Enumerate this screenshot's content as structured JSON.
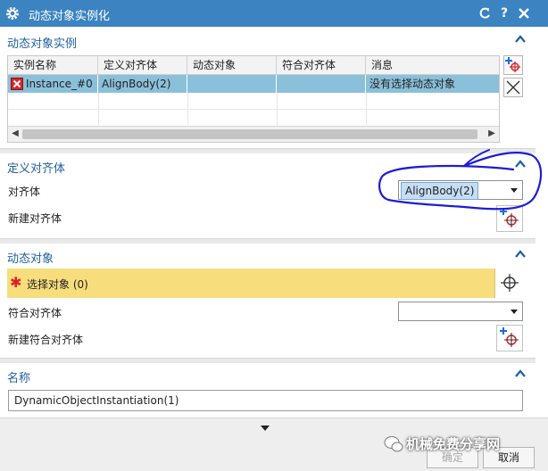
{
  "window": {
    "title": "动态对象实例化"
  },
  "instances_section": {
    "title": "动态对象实例",
    "columns": [
      "实例名称",
      "定义对齐体",
      "动态对象",
      "符合对齐体",
      "消息"
    ],
    "rows": [
      {
        "name": "Instance_#0",
        "align_body": "AlignBody(2)",
        "dynamic_object": "",
        "matching_body": "",
        "message": "没有选择动态对象"
      }
    ]
  },
  "define_section": {
    "title": "定义对齐体",
    "align_label": "对齐体",
    "align_value": "AlignBody(2)",
    "new_align_label": "新建对齐体"
  },
  "dynamic_section": {
    "title": "动态对象",
    "select_label": "选择对象 (0)",
    "matching_label": "符合对齐体",
    "matching_value": "",
    "new_matching_label": "新建符合对齐体"
  },
  "name_section": {
    "title": "名称",
    "name_value": "DynamicObjectInstantiation(1)"
  },
  "footer": {
    "ok_label": "确定",
    "cancel_label": "取消"
  },
  "watermark": {
    "text": "机械免费分享网"
  },
  "colors": {
    "title_bar": "#3b83c1",
    "section_title": "#1f5fa0",
    "selection_row": "#8ac0da",
    "required_row": "#f7dd7c",
    "annotation_ink": "#1c1cd8"
  }
}
